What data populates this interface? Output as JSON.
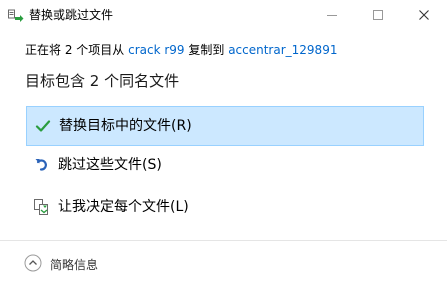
{
  "window": {
    "title": "替换或跳过文件",
    "icon": "file-transfer-icon"
  },
  "source_line": {
    "prefix": "正在将 2 个项目从 ",
    "source": "crack r99",
    "middle": " 复制到 ",
    "destination": "accentrar_129891"
  },
  "heading": "目标包含 2 个同名文件",
  "options": [
    {
      "label": "替换目标中的文件(R)",
      "icon": "checkmark-icon",
      "selected": true
    },
    {
      "label": "跳过这些文件(S)",
      "icon": "skip-arrow-icon",
      "selected": false
    },
    {
      "label": "让我决定每个文件(L)",
      "icon": "compare-files-icon",
      "selected": false
    }
  ],
  "footer": {
    "label": "简略信息",
    "icon": "chevron-up-circle-icon"
  },
  "colors": {
    "link": "#0066cc",
    "selected_bg": "#cce8ff",
    "selected_border": "#99d1ff",
    "check_green": "#2a9d3f",
    "skip_blue": "#2b63b8"
  }
}
